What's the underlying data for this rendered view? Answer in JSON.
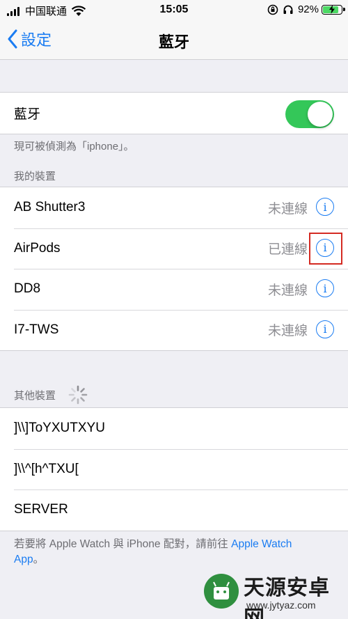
{
  "status_bar": {
    "carrier": "中国联通",
    "time": "15:05",
    "battery_percent": "92%",
    "battery_level": 0.92,
    "colors": {
      "battery_fill": "#4cd964"
    }
  },
  "nav": {
    "back_label": "設定",
    "title": "藍牙"
  },
  "bluetooth": {
    "label": "藍牙",
    "enabled": true,
    "discoverable_text": "現可被偵測為「iphone」。"
  },
  "my_devices": {
    "header": "我的裝置",
    "items": [
      {
        "name": "AB Shutter3",
        "status": "未連線"
      },
      {
        "name": "AirPods",
        "status": "已連線"
      },
      {
        "name": "DD8",
        "status": "未連線"
      },
      {
        "name": "I7-TWS",
        "status": "未連線"
      }
    ],
    "info_icon": "i"
  },
  "other_devices": {
    "header": "其他裝置",
    "items": [
      {
        "name": "]\\\\]ToYXUTXYU"
      },
      {
        "name": "]\\\\^[h^TXU["
      },
      {
        "name": "SERVER"
      }
    ]
  },
  "footer": {
    "text_before": "若要將 Apple Watch 與 iPhone 配對，請前往 ",
    "link": "Apple Watch App",
    "text_after": "。"
  },
  "watermark": {
    "name": "天源安卓网",
    "url": "www.jytyaz.com"
  },
  "colors": {
    "accent": "#1a7cf2",
    "toggle_on": "#34c759",
    "highlight": "#d42a22"
  }
}
